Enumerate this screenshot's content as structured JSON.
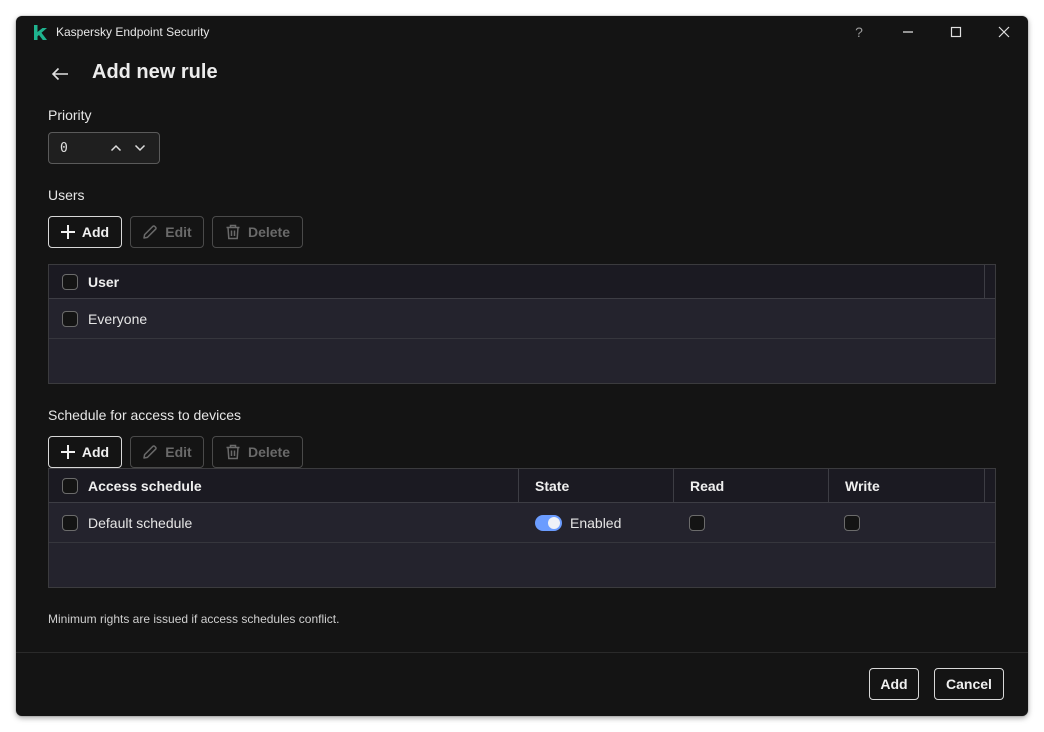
{
  "window": {
    "app_title": "Kaspersky Endpoint Security",
    "brand_color": "#1fb38f",
    "controls": {
      "help": "?",
      "minimize": "minimize-icon",
      "maximize": "maximize-icon",
      "close": "close-icon"
    }
  },
  "page": {
    "title": "Add new rule",
    "back_icon": "arrow-left-icon"
  },
  "priority": {
    "label": "Priority",
    "value": "0"
  },
  "users": {
    "label": "Users",
    "toolbar": {
      "add": "Add",
      "edit": "Edit",
      "delete": "Delete"
    },
    "columns": [
      "User"
    ],
    "rows": [
      {
        "user": "Everyone",
        "checked": false
      }
    ]
  },
  "schedule": {
    "label": "Schedule for access to devices",
    "toolbar": {
      "add": "Add",
      "edit": "Edit",
      "delete": "Delete"
    },
    "columns": [
      "Access schedule",
      "State",
      "Read",
      "Write"
    ],
    "rows": [
      {
        "name": "Default schedule",
        "state": "Enabled",
        "enabled": true,
        "read": false,
        "write": false
      }
    ],
    "toggle_color": "#6b9cff"
  },
  "note": "Minimum rights are issued if access schedules conflict.",
  "footer": {
    "add": "Add",
    "cancel": "Cancel"
  }
}
